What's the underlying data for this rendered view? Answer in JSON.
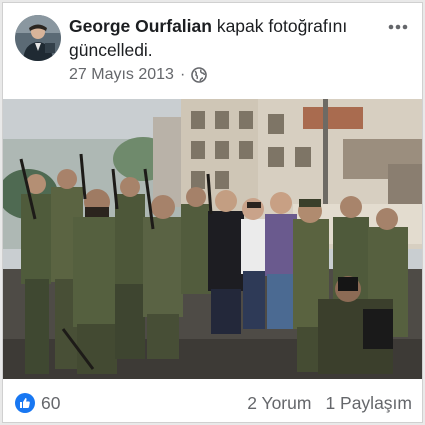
{
  "post": {
    "author": "George Ourfalian",
    "action": " kapak fotoğrafını güncelledi.",
    "date": "27 Mayıs 2013",
    "separator": "·",
    "privacy_icon": "globe-icon",
    "menu_icon": "more-options-icon"
  },
  "stats": {
    "like_count": "60",
    "comments": "2 Yorum",
    "shares": "1 Paylaşım"
  },
  "colors": {
    "like_blue": "#1877f2",
    "text_primary": "#1c1e21",
    "text_secondary": "#65676b"
  }
}
